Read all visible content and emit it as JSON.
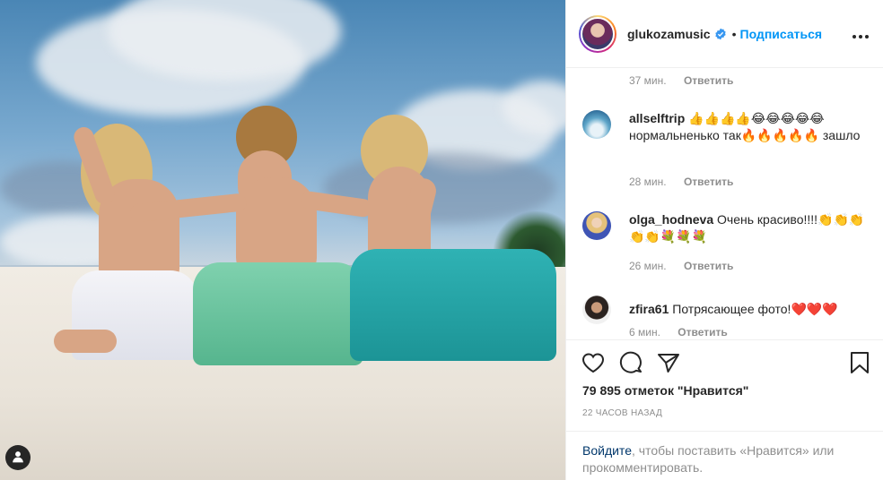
{
  "post": {
    "username": "glukozamusic",
    "separator": "•",
    "follow_label": "Подписаться",
    "more_label": "•••"
  },
  "comments": {
    "first_meta": {
      "time": "37 мин.",
      "reply": "Ответить"
    },
    "items": [
      {
        "user": "allselftrip",
        "text": "👍👍👍👍😂😂😂😂😂 нормальненько так🔥🔥🔥🔥🔥 зашло",
        "time": "28 мин.",
        "reply": "Ответить"
      },
      {
        "user": "olga_hodneva",
        "text": "Очень красиво!!!!👏👏👏👏👏💐💐💐",
        "time": "26 мин.",
        "reply": "Ответить"
      },
      {
        "user": "zfira61",
        "text": "Потрясающее фото!❤️❤️❤️",
        "time": "6 мин.",
        "reply": "Ответить"
      }
    ]
  },
  "icons": {
    "like": "heart-icon",
    "comment": "comment-icon",
    "share": "paper-plane-icon",
    "save": "bookmark-icon",
    "verified": "verified-badge-icon",
    "photo_user": "user-silhouette-icon"
  },
  "stats": {
    "likes": "79 895 отметок \"Нравится\"",
    "time_ago": "22 часов назад"
  },
  "login_prompt": {
    "link": "Войдите",
    "rest": ", чтобы поставить «Нравится» или прокомментировать."
  },
  "colors": {
    "accent": "#0095f6",
    "muted": "#8e8e8e",
    "text": "#262626"
  }
}
